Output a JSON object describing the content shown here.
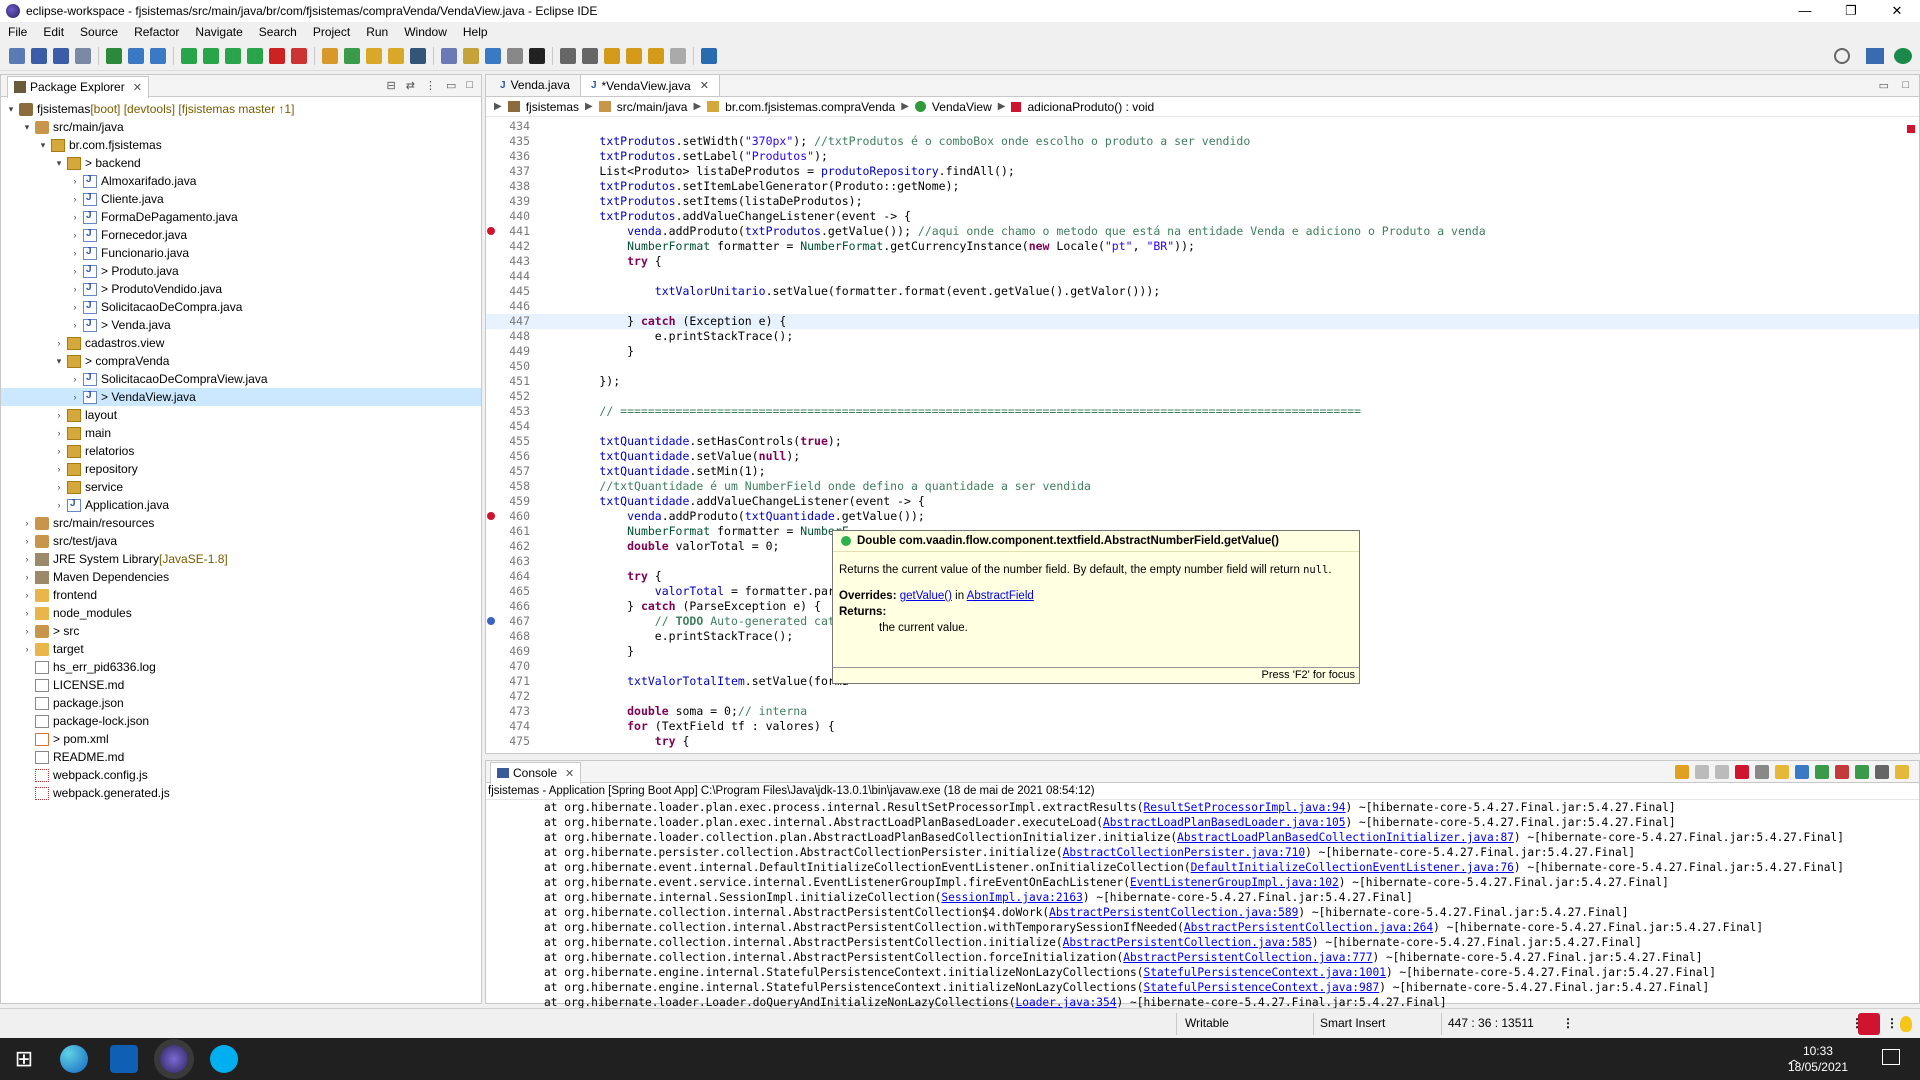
{
  "window": {
    "title": "eclipse-workspace - fjsistemas/src/main/java/br/com/fjsistemas/compraVenda/VendaView.java - Eclipse IDE",
    "minimize": "—",
    "maximize": "❐",
    "close": "✕"
  },
  "menu": [
    "File",
    "Edit",
    "Source",
    "Refactor",
    "Navigate",
    "Search",
    "Project",
    "Run",
    "Window",
    "Help"
  ],
  "package_explorer": {
    "title": "Package Explorer",
    "tree": [
      {
        "indent": 0,
        "arrow": "▾",
        "icon": "project",
        "label": "fjsistemas",
        "decor": " [boot] [devtools] [fjsistemas master ↑1]"
      },
      {
        "indent": 1,
        "arrow": "▾",
        "icon": "srcfolder",
        "label": "src/main/java",
        "decor": ""
      },
      {
        "indent": 2,
        "arrow": "▾",
        "icon": "pkg",
        "label": "br.com.fjsistemas",
        "decor": ""
      },
      {
        "indent": 3,
        "arrow": "▾",
        "icon": "pkg",
        "label": "> backend",
        "decor": ""
      },
      {
        "indent": 4,
        "arrow": "›",
        "icon": "java",
        "label": "Almoxarifado.java",
        "decor": ""
      },
      {
        "indent": 4,
        "arrow": "›",
        "icon": "java",
        "label": "Cliente.java",
        "decor": ""
      },
      {
        "indent": 4,
        "arrow": "›",
        "icon": "java",
        "label": "FormaDePagamento.java",
        "decor": ""
      },
      {
        "indent": 4,
        "arrow": "›",
        "icon": "java",
        "label": "Fornecedor.java",
        "decor": ""
      },
      {
        "indent": 4,
        "arrow": "›",
        "icon": "java",
        "label": "Funcionario.java",
        "decor": ""
      },
      {
        "indent": 4,
        "arrow": "›",
        "icon": "java",
        "label": "> Produto.java",
        "decor": ""
      },
      {
        "indent": 4,
        "arrow": "›",
        "icon": "java",
        "label": "> ProdutoVendido.java",
        "decor": ""
      },
      {
        "indent": 4,
        "arrow": "›",
        "icon": "java",
        "label": "SolicitacaoDeCompra.java",
        "decor": ""
      },
      {
        "indent": 4,
        "arrow": "›",
        "icon": "java",
        "label": "> Venda.java",
        "decor": ""
      },
      {
        "indent": 3,
        "arrow": "›",
        "icon": "pkg",
        "label": "cadastros.view",
        "decor": ""
      },
      {
        "indent": 3,
        "arrow": "▾",
        "icon": "pkg",
        "label": "> compraVenda",
        "decor": ""
      },
      {
        "indent": 4,
        "arrow": "›",
        "icon": "java",
        "label": "SolicitacaoDeCompraView.java",
        "decor": ""
      },
      {
        "indent": 4,
        "arrow": "›",
        "icon": "java",
        "label": "> VendaView.java",
        "decor": "",
        "selected": true
      },
      {
        "indent": 3,
        "arrow": "›",
        "icon": "pkg",
        "label": "layout",
        "decor": ""
      },
      {
        "indent": 3,
        "arrow": "›",
        "icon": "pkg",
        "label": "main",
        "decor": ""
      },
      {
        "indent": 3,
        "arrow": "›",
        "icon": "pkg",
        "label": "relatorios",
        "decor": ""
      },
      {
        "indent": 3,
        "arrow": "›",
        "icon": "pkg",
        "label": "repository",
        "decor": ""
      },
      {
        "indent": 3,
        "arrow": "›",
        "icon": "pkg",
        "label": "service",
        "decor": ""
      },
      {
        "indent": 3,
        "arrow": "›",
        "icon": "java",
        "label": "Application.java",
        "decor": ""
      },
      {
        "indent": 1,
        "arrow": "›",
        "icon": "srcfolder",
        "label": "src/main/resources",
        "decor": ""
      },
      {
        "indent": 1,
        "arrow": "›",
        "icon": "srcfolder",
        "label": "src/test/java",
        "decor": ""
      },
      {
        "indent": 1,
        "arrow": "›",
        "icon": "lib",
        "label": "JRE System Library",
        "decor": " [JavaSE-1.8]"
      },
      {
        "indent": 1,
        "arrow": "›",
        "icon": "lib",
        "label": "Maven Dependencies",
        "decor": ""
      },
      {
        "indent": 1,
        "arrow": "›",
        "icon": "folder",
        "label": "frontend",
        "decor": ""
      },
      {
        "indent": 1,
        "arrow": "›",
        "icon": "folder",
        "label": "node_modules",
        "decor": ""
      },
      {
        "indent": 1,
        "arrow": "›",
        "icon": "srcfolder",
        "label": "> src",
        "decor": ""
      },
      {
        "indent": 1,
        "arrow": "›",
        "icon": "folder",
        "label": "target",
        "decor": ""
      },
      {
        "indent": 1,
        "arrow": "",
        "icon": "log",
        "label": "hs_err_pid6336.log",
        "decor": ""
      },
      {
        "indent": 1,
        "arrow": "",
        "icon": "file",
        "label": "LICENSE.md",
        "decor": ""
      },
      {
        "indent": 1,
        "arrow": "",
        "icon": "file",
        "label": "package.json",
        "decor": ""
      },
      {
        "indent": 1,
        "arrow": "",
        "icon": "file",
        "label": "package-lock.json",
        "decor": ""
      },
      {
        "indent": 1,
        "arrow": "",
        "icon": "xml",
        "label": "> pom.xml",
        "decor": ""
      },
      {
        "indent": 1,
        "arrow": "",
        "icon": "file",
        "label": "README.md",
        "decor": ""
      },
      {
        "indent": 1,
        "arrow": "",
        "icon": "js",
        "label": "webpack.config.js",
        "decor": ""
      },
      {
        "indent": 1,
        "arrow": "",
        "icon": "js",
        "label": "webpack.generated.js",
        "decor": ""
      }
    ]
  },
  "editor": {
    "tabs": [
      {
        "label": "Venda.java",
        "active": false
      },
      {
        "label": "*VendaView.java",
        "active": true
      }
    ],
    "breadcrumb": [
      "fjsistemas",
      "src/main/java",
      "br.com.fjsistemas.compraVenda",
      "VendaView",
      "adicionaProduto() : void"
    ],
    "lines": [
      {
        "n": "434",
        "html": ""
      },
      {
        "n": "435",
        "html": "        <span class='f'>txtProdutos</span>.setWidth(<span class='s'>\"370px\"</span>); <span class='c'>//txtProdutos é o comboBox onde escolho o produto a ser vendido</span>"
      },
      {
        "n": "436",
        "html": "        <span class='f'>txtProdutos</span>.setLabel(<span class='s'>\"Produtos\"</span>);"
      },
      {
        "n": "437",
        "html": "        List&lt;Produto&gt; listaDeProdutos = <span class='f'>produtoRepository</span>.findAll();"
      },
      {
        "n": "438",
        "html": "        <span class='f'>txtProdutos</span>.setItemLabelGenerator(Produto::getNome);"
      },
      {
        "n": "439",
        "html": "        <span class='f'>txtProdutos</span>.setItems(listaDeProdutos);"
      },
      {
        "n": "440",
        "html": "        <span class='f'>txtProdutos</span>.addValueChangeListener(event -&gt; {"
      },
      {
        "n": "441",
        "html": "            <span class='f'>venda</span>.addProduto(<span class='f'>txtProdutos</span>.getValue()); <span class='c'>//aqui onde chamo o metodo que está na entidade Venda e adiciono o Produto a venda</span>",
        "bp": "red"
      },
      {
        "n": "442",
        "html": "            <span class='t'>NumberFormat</span> formatter = <span class='t'>NumberFormat</span>.getCurrencyInstance(<span class='k'>new</span> Locale(<span class='s'>\"pt\"</span>, <span class='s'>\"BR\"</span>));"
      },
      {
        "n": "443",
        "html": "            <span class='k'>try</span> {"
      },
      {
        "n": "444",
        "html": ""
      },
      {
        "n": "445",
        "html": "                <span class='f'>txtValorUnitario</span>.setValue(formatter.format(event.getValue().getValor()));"
      },
      {
        "n": "446",
        "html": ""
      },
      {
        "n": "447",
        "html": "            } <span class='k'>catch</span> (Exception e) {",
        "cur": true
      },
      {
        "n": "448",
        "html": "                e.printStackTrace();"
      },
      {
        "n": "449",
        "html": "            }"
      },
      {
        "n": "450",
        "html": ""
      },
      {
        "n": "451",
        "html": "        });"
      },
      {
        "n": "452",
        "html": ""
      },
      {
        "n": "453",
        "html": "        <span class='c'>// ===========================================================================================================</span>"
      },
      {
        "n": "454",
        "html": ""
      },
      {
        "n": "455",
        "html": "        <span class='f'>txtQuantidade</span>.setHasControls(<span class='k'>true</span>);"
      },
      {
        "n": "456",
        "html": "        <span class='f'>txtQuantidade</span>.setValue(<span class='k'>null</span>);"
      },
      {
        "n": "457",
        "html": "        <span class='f'>txtQuantidade</span>.setMin(1);"
      },
      {
        "n": "458",
        "html": "        <span class='c'>//txtQuantidade é um NumberField onde defino a quantidade a ser vendida</span>"
      },
      {
        "n": "459",
        "html": "        <span class='f'>txtQuantidade</span>.addValueChangeListener(event -&gt; {"
      },
      {
        "n": "460",
        "html": "            <span class='f'>venda</span>.addProduto(<span class='f'>txtQuantidade</span>.getValue());",
        "bp": "red"
      },
      {
        "n": "461",
        "html": "            <span class='t'>NumberFormat</span> formatter = <span class='t'>NumberF</span>"
      },
      {
        "n": "462",
        "html": "            <span class='k'>double</span> valorTotal = 0;"
      },
      {
        "n": "463",
        "html": ""
      },
      {
        "n": "464",
        "html": "            <span class='k'>try</span> {"
      },
      {
        "n": "465",
        "html": "                <span class='f'>valorTotal</span> = formatter.pars"
      },
      {
        "n": "466",
        "html": "            } <span class='k'>catch</span> (ParseException e) {"
      },
      {
        "n": "467",
        "html": "                <span class='c'>// <b>TODO</b> Auto-generated catc</span>",
        "bp": "blue"
      },
      {
        "n": "468",
        "html": "                e.printStackTrace();"
      },
      {
        "n": "469",
        "html": "            }"
      },
      {
        "n": "470",
        "html": ""
      },
      {
        "n": "471",
        "html": "            <span class='f'>txtValorTotalItem</span>.setValue(forma"
      },
      {
        "n": "472",
        "html": ""
      },
      {
        "n": "473",
        "html": "            <span class='k'>double</span> soma = 0;<span class='c'>// interna</span>"
      },
      {
        "n": "474",
        "html": "            <span class='k'>for</span> (TextField tf : valores) {"
      },
      {
        "n": "475",
        "html": "                <span class='k'>try</span> {"
      }
    ]
  },
  "hover": {
    "signature": "Double com.vaadin.flow.component.textfield.AbstractNumberField.getValue()",
    "desc": "Returns the current value of the number field. By default, the empty number field will return",
    "desc_code": "null",
    "desc_end": ".",
    "overrides_label": "Overrides:",
    "overrides_link": "getValue()",
    "overrides_in": " in ",
    "overrides_class": "AbstractField",
    "returns_label": "Returns:",
    "returns_value": "the current value.",
    "footer": "Press 'F2' for focus"
  },
  "console": {
    "title": "Console",
    "description": "fjsistemas - Application [Spring Boot App] C:\\Program Files\\Java\\jdk-13.0.1\\bin\\javaw.exe  (18 de mai de 2021 08:54:12)",
    "lines": [
      {
        "pre": "at org.hibernate.loader.plan.exec.process.internal.ResultSetProcessorImpl.extractResults(",
        "link": "ResultSetProcessorImpl.java:94",
        "post": ") ~[hibernate-core-5.4.27.Final.jar:5.4.27.Final]"
      },
      {
        "pre": "at org.hibernate.loader.plan.exec.internal.AbstractLoadPlanBasedLoader.executeLoad(",
        "link": "AbstractLoadPlanBasedLoader.java:105",
        "post": ") ~[hibernate-core-5.4.27.Final.jar:5.4.27.Final]"
      },
      {
        "pre": "at org.hibernate.loader.collection.plan.AbstractLoadPlanBasedCollectionInitializer.initialize(",
        "link": "AbstractLoadPlanBasedCollectionInitializer.java:87",
        "post": ") ~[hibernate-core-5.4.27.Final.jar:5.4.27.Final]"
      },
      {
        "pre": "at org.hibernate.persister.collection.AbstractCollectionPersister.initialize(",
        "link": "AbstractCollectionPersister.java:710",
        "post": ") ~[hibernate-core-5.4.27.Final.jar:5.4.27.Final]"
      },
      {
        "pre": "at org.hibernate.event.internal.DefaultInitializeCollectionEventListener.onInitializeCollection(",
        "link": "DefaultInitializeCollectionEventListener.java:76",
        "post": ") ~[hibernate-core-5.4.27.Final.jar:5.4.27.Final]"
      },
      {
        "pre": "at org.hibernate.event.service.internal.EventListenerGroupImpl.fireEventOnEachListener(",
        "link": "EventListenerGroupImpl.java:102",
        "post": ") ~[hibernate-core-5.4.27.Final.jar:5.4.27.Final]"
      },
      {
        "pre": "at org.hibernate.internal.SessionImpl.initializeCollection(",
        "link": "SessionImpl.java:2163",
        "post": ") ~[hibernate-core-5.4.27.Final.jar:5.4.27.Final]"
      },
      {
        "pre": "at org.hibernate.collection.internal.AbstractPersistentCollection$4.doWork(",
        "link": "AbstractPersistentCollection.java:589",
        "post": ") ~[hibernate-core-5.4.27.Final.jar:5.4.27.Final]"
      },
      {
        "pre": "at org.hibernate.collection.internal.AbstractPersistentCollection.withTemporarySessionIfNeeded(",
        "link": "AbstractPersistentCollection.java:264",
        "post": ") ~[hibernate-core-5.4.27.Final.jar:5.4.27.Final]"
      },
      {
        "pre": "at org.hibernate.collection.internal.AbstractPersistentCollection.initialize(",
        "link": "AbstractPersistentCollection.java:585",
        "post": ") ~[hibernate-core-5.4.27.Final.jar:5.4.27.Final]"
      },
      {
        "pre": "at org.hibernate.collection.internal.AbstractPersistentCollection.forceInitialization(",
        "link": "AbstractPersistentCollection.java:777",
        "post": ") ~[hibernate-core-5.4.27.Final.jar:5.4.27.Final]"
      },
      {
        "pre": "at org.hibernate.engine.internal.StatefulPersistenceContext.initializeNonLazyCollections(",
        "link": "StatefulPersistenceContext.java:1001",
        "post": ") ~[hibernate-core-5.4.27.Final.jar:5.4.27.Final]"
      },
      {
        "pre": "at org.hibernate.engine.internal.StatefulPersistenceContext.initializeNonLazyCollections(",
        "link": "StatefulPersistenceContext.java:987",
        "post": ") ~[hibernate-core-5.4.27.Final.jar:5.4.27.Final]"
      },
      {
        "pre": "at org.hibernate.loader.Loader.doQueryAndInitializeNonLazyCollections(",
        "link": "Loader.java:354",
        "post": ") ~[hibernate-core-5.4.27.Final.jar:5.4.27.Final]"
      }
    ]
  },
  "status": {
    "writable": "Writable",
    "insert_mode": "Smart Insert",
    "position": "447 : 36 : 13511"
  },
  "taskbar": {
    "time": "10:33",
    "date": "18/05/2021"
  }
}
